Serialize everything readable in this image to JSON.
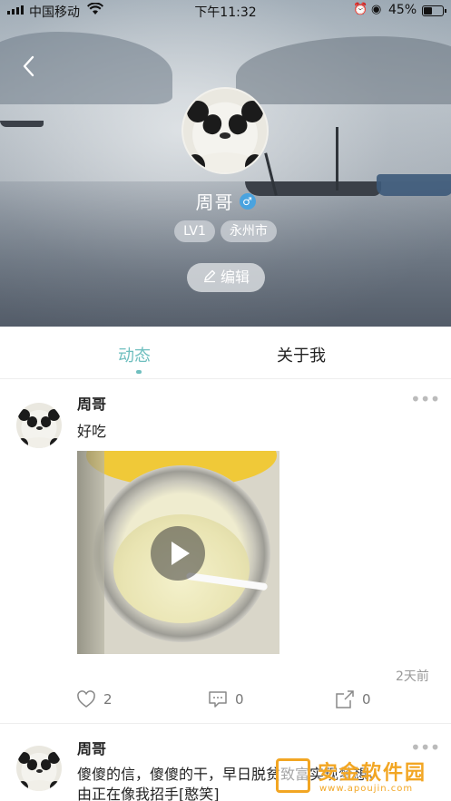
{
  "status_bar": {
    "carrier": "中国移动",
    "time": "下午11:32",
    "battery": "45%",
    "battery_level": 0.45
  },
  "profile": {
    "name": "周哥",
    "gender_symbol": "♂",
    "level": "LV1",
    "city": "永州市",
    "edit_label": "编辑"
  },
  "tabs": [
    {
      "label": "动态",
      "active": true
    },
    {
      "label": "关于我",
      "active": false
    }
  ],
  "posts": [
    {
      "author": "周哥",
      "text": "好吃",
      "media": "video",
      "time_ago": "2天前",
      "likes": "2",
      "comments": "0",
      "shares": "0"
    },
    {
      "author": "周哥",
      "text_line1": "傻傻的信，傻傻的干，早日脱贫致富实现梦想，",
      "text_line2": "由正在像我招手[憨笑]"
    }
  ],
  "watermark": {
    "text": "安金软件园",
    "url": "www.apoujin.com"
  },
  "colors": {
    "accent": "#6fbfbf",
    "gender_badge": "#4aa3df",
    "watermark": "#f2a623"
  }
}
